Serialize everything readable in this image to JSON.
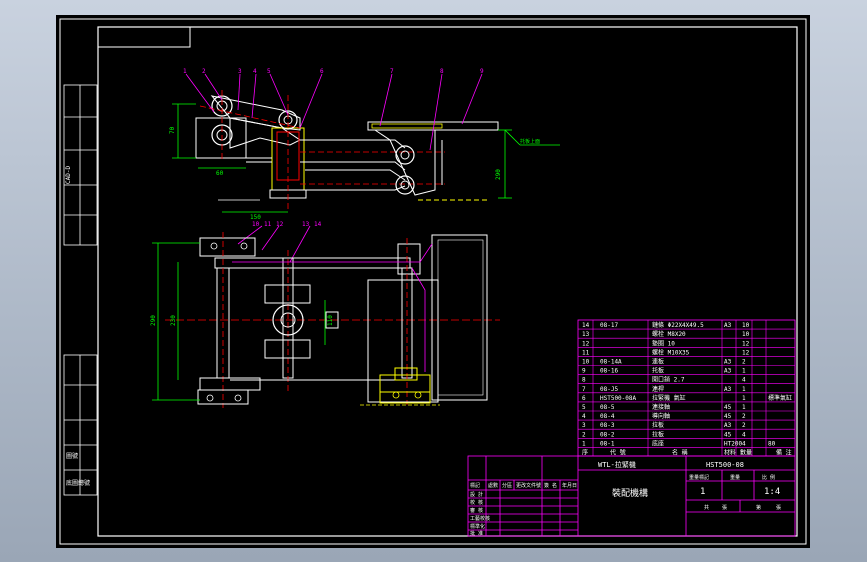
{
  "drawing": {
    "title_left": "WTL-拉緊機",
    "title_right": "HST500-08",
    "drawing_name": "裝配機構",
    "scale": "1:4",
    "sheet_count": "1",
    "header_cells": [
      "重量標記",
      "重量",
      "比 例"
    ],
    "footer_cells": [
      "共",
      "張",
      "第",
      "張"
    ],
    "sign_labels": [
      "標記",
      "設 計",
      "校 核",
      "審 核",
      "工藝校核",
      "標準化",
      "批 准"
    ],
    "sign_header": [
      "處數",
      "分區",
      "更改文件號",
      "簽 名",
      "年月日"
    ],
    "left_strip_labels": [
      "CAD-D",
      "圖號",
      "底圖總號"
    ],
    "color_magenta": "#ff00ff",
    "color_yellow": "#ffff00",
    "color_red": "#ff0000",
    "color_green": "#00ff00",
    "color_cyan": "#00ffff"
  },
  "bom": {
    "header": [
      "序",
      "代 號",
      "名 稱",
      "材料",
      "數量",
      "備 注"
    ],
    "rows": [
      {
        "no": "14",
        "code": "08-17",
        "name": "鏈條 Φ22X4X49.5",
        "mat": "A3",
        "qty": "10",
        "note": ""
      },
      {
        "no": "13",
        "code": "",
        "name": "螺栓 M8X20",
        "mat": "",
        "qty": "10",
        "note": ""
      },
      {
        "no": "12",
        "code": "",
        "name": "墊圈 10",
        "mat": "",
        "qty": "12",
        "note": ""
      },
      {
        "no": "11",
        "code": "",
        "name": "螺栓 M10X35",
        "mat": "",
        "qty": "12",
        "note": ""
      },
      {
        "no": "10",
        "code": "08-14A",
        "name": "連板",
        "mat": "A3",
        "qty": "2",
        "note": ""
      },
      {
        "no": "9",
        "code": "08-16",
        "name": "托板",
        "mat": "A3",
        "qty": "1",
        "note": ""
      },
      {
        "no": "8",
        "code": "",
        "name": "開口銷 2.7",
        "mat": "",
        "qty": "4",
        "note": ""
      },
      {
        "no": "7",
        "code": "08-J5",
        "name": "連桿",
        "mat": "A3",
        "qty": "1",
        "note": ""
      },
      {
        "no": "6",
        "code": "HST500-08A",
        "name": "拉緊機 氣缸",
        "mat": "",
        "qty": "1",
        "note": "標準氣缸"
      },
      {
        "no": "5",
        "code": "08-5",
        "name": "連接軸",
        "mat": "45",
        "qty": "1",
        "note": ""
      },
      {
        "no": "4",
        "code": "08-4",
        "name": "導向軸",
        "mat": "45",
        "qty": "2",
        "note": ""
      },
      {
        "no": "3",
        "code": "08-3",
        "name": "拉板",
        "mat": "A3",
        "qty": "2",
        "note": ""
      },
      {
        "no": "2",
        "code": "08-2",
        "name": "拉板",
        "mat": "45",
        "qty": "4",
        "note": ""
      },
      {
        "no": "1",
        "code": "08-1",
        "name": "底座",
        "mat": "HT200",
        "qty": "4",
        "note": "80"
      }
    ]
  },
  "callouts": [
    "1",
    "2",
    "3",
    "4",
    "5",
    "6",
    "7",
    "8",
    "9",
    "10",
    "11",
    "12",
    "13",
    "14"
  ],
  "dims": {
    "d_70": "70",
    "d_60": "60",
    "d_150": "150",
    "d_290": "290",
    "d_230": "230",
    "d_110": "110",
    "d_note": "托板上面"
  }
}
